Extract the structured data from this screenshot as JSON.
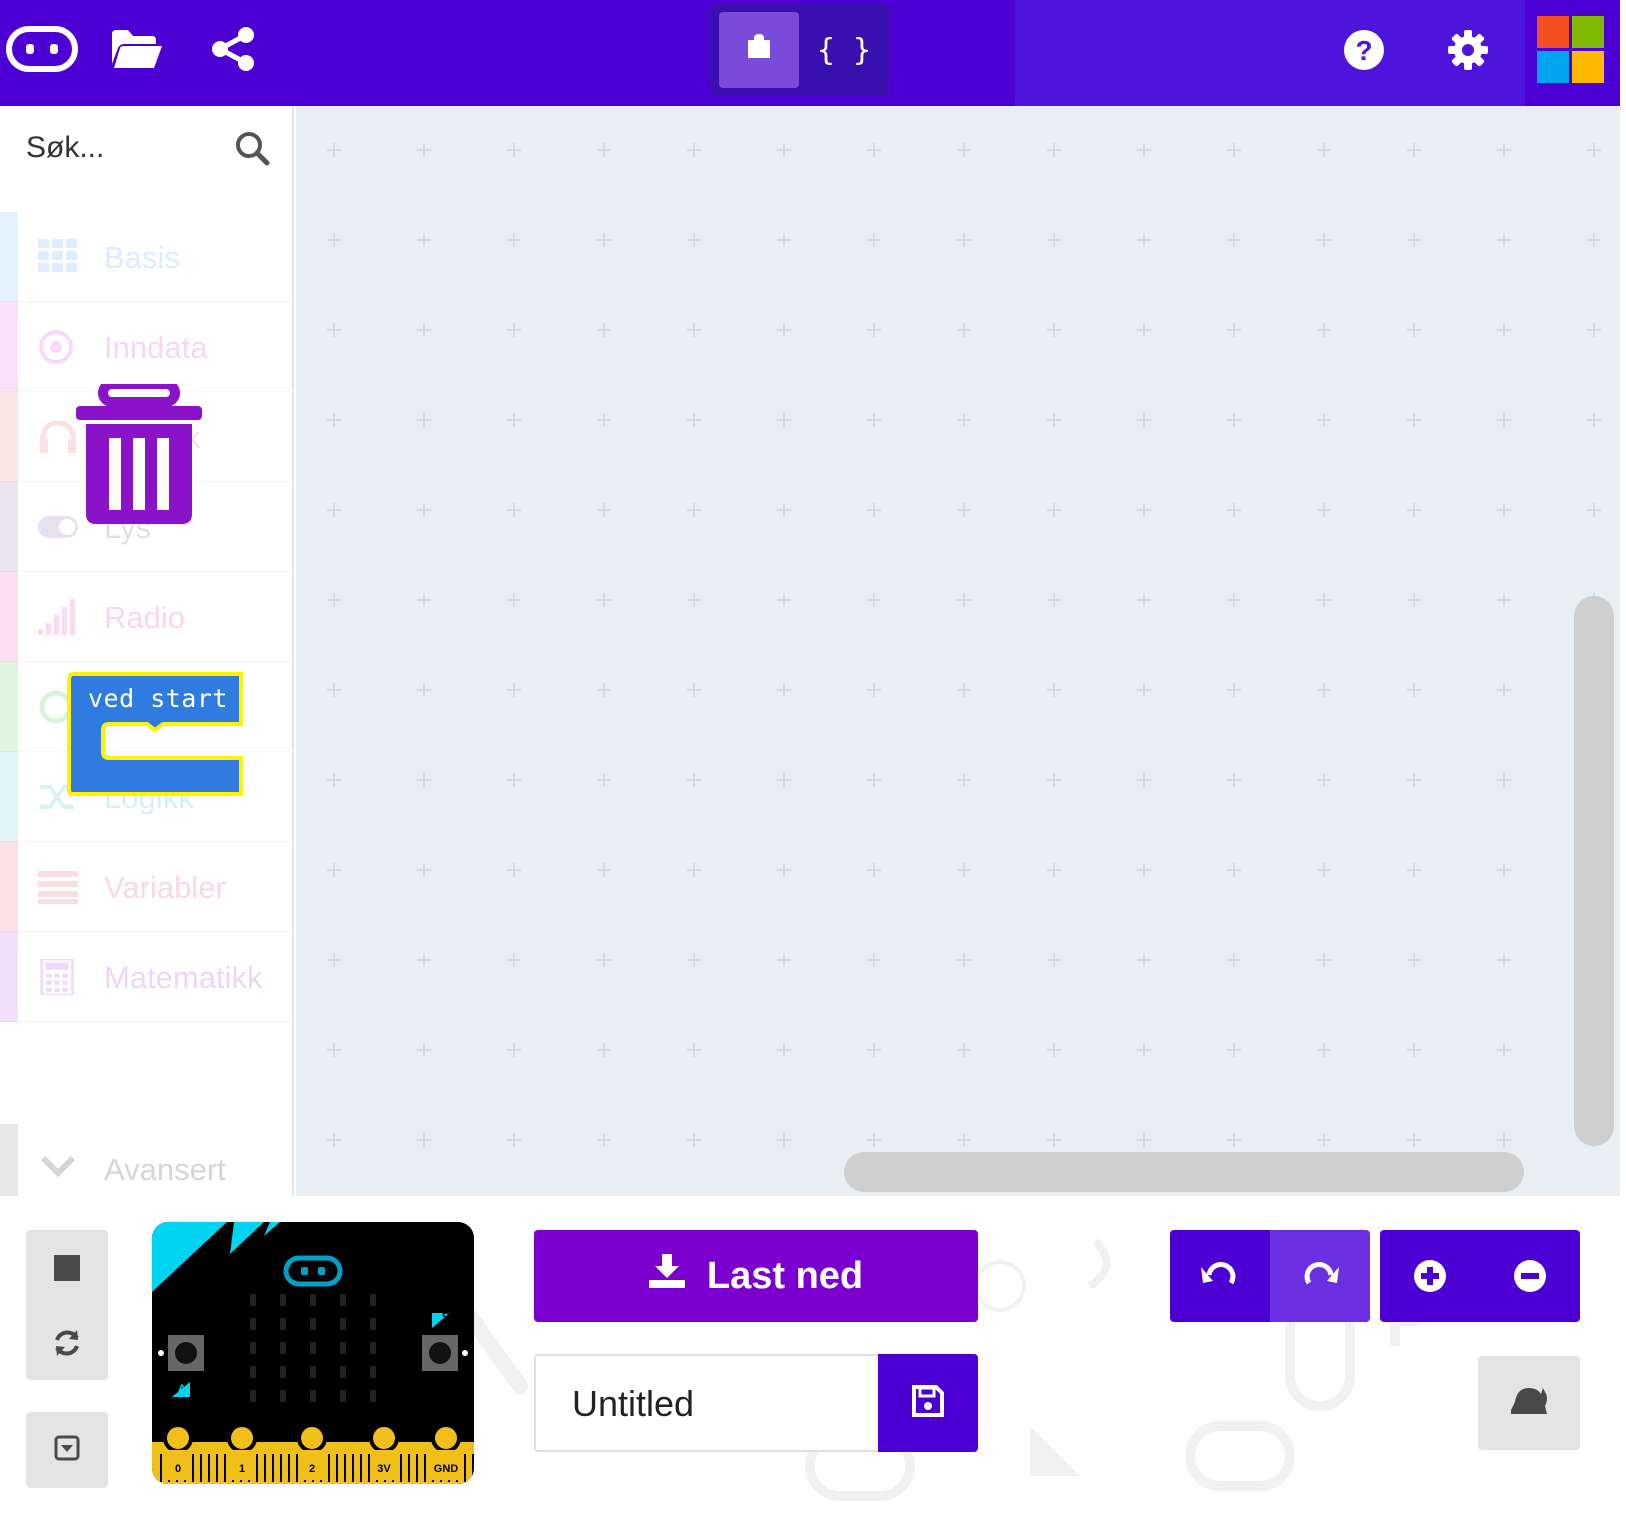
{
  "header": {
    "logo_icon": "microbit-logo-icon",
    "open_icon": "folder-open-icon",
    "share_icon": "share-icon",
    "mode_blocks_icon": "puzzle-piece-icon",
    "mode_js_label": "{ }",
    "help_icon": "help-icon",
    "settings_icon": "gear-icon",
    "ms_logo": "microsoft-logo",
    "colors": {
      "bar": "#4c00d4",
      "active_toggle": "#7a4ad8"
    }
  },
  "toolbox": {
    "search": {
      "placeholder": "Søk...",
      "icon": "search-icon"
    },
    "categories": [
      {
        "label": "Basis",
        "icon": "grid-icon",
        "color": "#1e90ff"
      },
      {
        "label": "Inndata",
        "icon": "target-icon",
        "color": "#d400d4"
      },
      {
        "label": "Musikk",
        "icon": "headphones-icon",
        "color": "#e63022"
      },
      {
        "label": "Lys",
        "icon": "toggle-icon",
        "color": "#5c2d91"
      },
      {
        "label": "Radio",
        "icon": "signal-bars-icon",
        "color": "#e3008c"
      },
      {
        "label": "Løkker",
        "icon": "refresh-icon",
        "color": "#00aa00"
      },
      {
        "label": "Logikk",
        "icon": "shuffle-icon",
        "color": "#00a4a6"
      },
      {
        "label": "Variabler",
        "icon": "list-icon",
        "color": "#dc143c"
      },
      {
        "label": "Matematikk",
        "icon": "calculator-icon",
        "color": "#9400d3"
      }
    ],
    "advanced": {
      "label": "Avansert",
      "icon": "chevron-down-icon"
    }
  },
  "drag": {
    "trash_icon": "trash-icon",
    "block_label": "ved start",
    "block_color": "#1e90ff",
    "block_outline": "#fff200"
  },
  "simulator": {
    "stop_icon": "stop-icon",
    "restart_icon": "restart-icon",
    "collapse_icon": "collapse-icon",
    "pins": [
      "0",
      "1",
      "2",
      "3V",
      "GND"
    ],
    "button_a": "A",
    "button_b": "B"
  },
  "actions": {
    "download_label": "Last ned",
    "download_icon": "download-icon",
    "project_name": "Untitled",
    "save_icon": "save-icon",
    "undo_icon": "undo-icon",
    "redo_icon": "redo-icon",
    "zoom_in_icon": "zoom-in-icon",
    "zoom_out_icon": "zoom-out-icon",
    "slow_icon": "snail-icon"
  }
}
